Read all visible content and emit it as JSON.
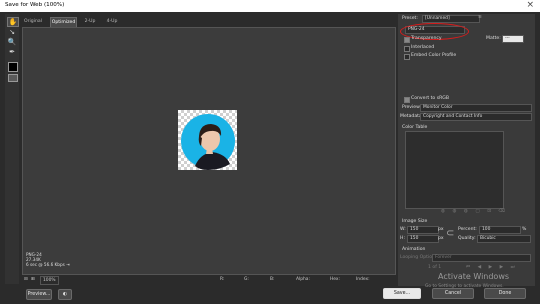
{
  "window": {
    "title": "Save for Web (100%)",
    "close": "×"
  },
  "tabs": [
    "Original",
    "Optimized",
    "2-Up",
    "4-Up"
  ],
  "tools": [
    {
      "name": "hand-tool",
      "glyph": "✋"
    },
    {
      "name": "slice-select-tool",
      "glyph": "↘"
    },
    {
      "name": "zoom-tool",
      "glyph": "🔍"
    },
    {
      "name": "eyedropper-tool",
      "glyph": "✒"
    }
  ],
  "info": {
    "format": "PNG-24",
    "size": "27.34K",
    "time": "6 sec @ 56.6 Kbps",
    "arrow": "⇥"
  },
  "status": {
    "zoom": "100%",
    "r": "R:",
    "g": "G:",
    "b": "B:",
    "alpha": "Alpha:",
    "hex": "Hex:",
    "index": "Index:"
  },
  "buttons": {
    "preview": "Preview...",
    "save": "Save...",
    "cancel": "Cancel",
    "done": "Done"
  },
  "panel": {
    "preset_label": "Preset:",
    "preset_value": "[Unnamed]",
    "format_value": "PNG-24",
    "transparency": "Transparency",
    "matte_label": "Matte:",
    "matte_value": "---",
    "interlaced": "Interlaced",
    "embed_color_profile": "Embed Color Profile",
    "convert_srgb": "Convert to sRGB",
    "preview_label": "Preview:",
    "preview_value": "Monitor Color",
    "metadata_label": "Metadata:",
    "metadata_value": "Copyright and Contact Info",
    "color_table": "Color Table",
    "image_size": "Image Size",
    "w_label": "W:",
    "w_value": "150",
    "w_unit": "px",
    "h_label": "H:",
    "h_value": "150",
    "h_unit": "px",
    "percent_label": "Percent:",
    "percent_value": "100",
    "percent_unit": "%",
    "quality_label": "Quality:",
    "quality_value": "Bicubic",
    "animation": "Animation",
    "looping_label": "Looping Options:",
    "looping_value": "Forever",
    "frame_counter": "1 of 1"
  },
  "watermark": {
    "line1": "Activate Windows",
    "line2": "Go to Settings to activate Windows."
  },
  "colors": {
    "accent_ring": "#d51c1c",
    "avatar_bg": "#1ab3e6"
  }
}
